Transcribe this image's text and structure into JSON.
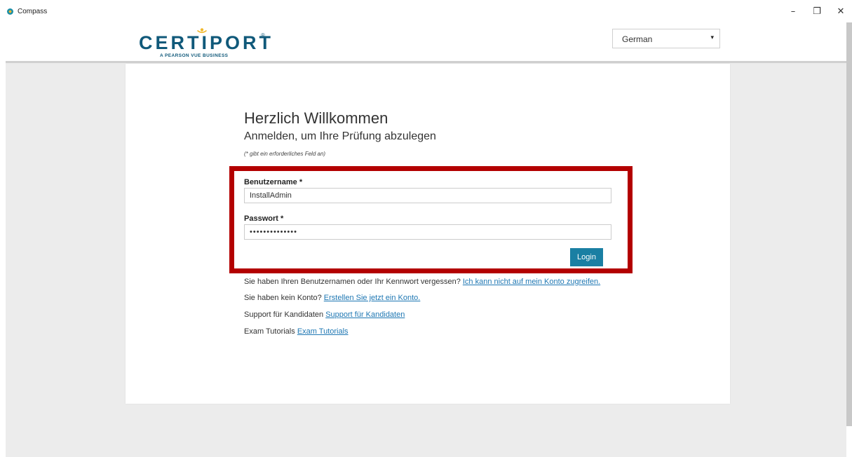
{
  "window": {
    "title": "Compass",
    "controls": {
      "minimize": "–",
      "restore": "❐",
      "close": "✕"
    }
  },
  "header": {
    "logo": {
      "name": "CERTIPORT",
      "tagline": "A PEARSON VUE BUSINESS"
    },
    "language": {
      "selected": "German",
      "arrow": "▾"
    }
  },
  "login": {
    "title": "Herzlich Willkommen",
    "subtitle": "Anmelden, um Ihre Prüfung abzulegen",
    "required_note": "(* gibt ein erforderliches Feld an)",
    "username_label": "Benutzername *",
    "username_value": "InstallAdmin",
    "password_label": "Passwort *",
    "password_value": "••••••••••••••",
    "login_button": "Login"
  },
  "links": [
    {
      "text": "Sie haben Ihren Benutzernamen oder Ihr Kennwort vergessen?",
      "link": "Ich kann nicht auf mein Konto zugreifen."
    },
    {
      "text": "Sie haben kein Konto?",
      "link": "Erstellen Sie jetzt ein Konto."
    },
    {
      "text": "Support für Kandidaten",
      "link": "Support für Kandidaten"
    },
    {
      "text": "Exam Tutorials",
      "link": "Exam Tutorials"
    }
  ],
  "colors": {
    "brand": "#10597a",
    "button": "#1a7fa3",
    "highlight": "#b30000",
    "link": "#1e77b3",
    "background": "#ececec"
  }
}
